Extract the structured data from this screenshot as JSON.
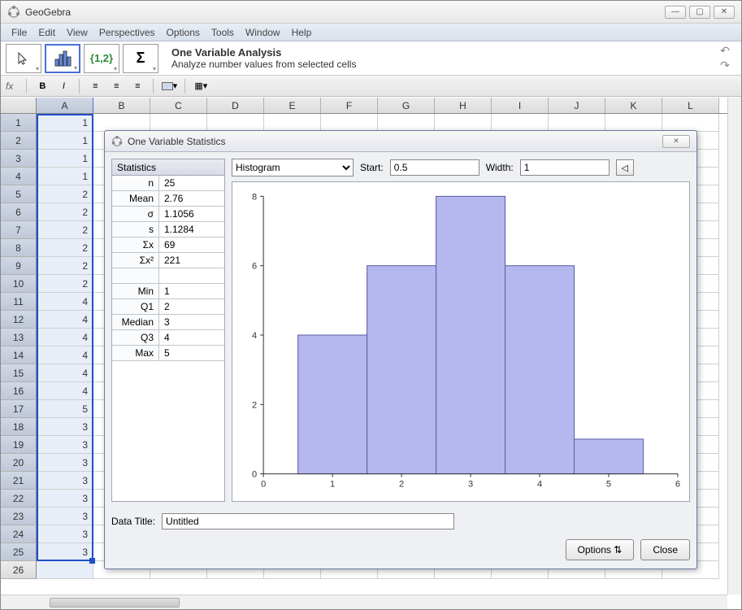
{
  "app": {
    "title": "GeoGebra"
  },
  "menu": {
    "items": [
      "File",
      "Edit",
      "View",
      "Perspectives",
      "Options",
      "Tools",
      "Window",
      "Help"
    ]
  },
  "toolbar": {
    "desc_title": "One Variable Analysis",
    "desc_sub": "Analyze number values from selected cells",
    "braces_label": "{1,2}",
    "sigma_label": "Σ"
  },
  "formatbar": {
    "fx": "fx",
    "bold": "B",
    "italic": "I"
  },
  "columns": [
    "A",
    "B",
    "C",
    "D",
    "E",
    "F",
    "G",
    "H",
    "I",
    "J",
    "K",
    "L"
  ],
  "rows": [
    "1",
    "2",
    "3",
    "4",
    "5",
    "6",
    "7",
    "8",
    "9",
    "10",
    "11",
    "12",
    "13",
    "14",
    "15",
    "16",
    "17",
    "18",
    "19",
    "20",
    "21",
    "22",
    "23",
    "24",
    "25",
    "26"
  ],
  "data_col_a": [
    "1",
    "1",
    "1",
    "1",
    "2",
    "2",
    "2",
    "2",
    "2",
    "2",
    "4",
    "4",
    "4",
    "4",
    "4",
    "4",
    "5",
    "3",
    "3",
    "3",
    "3",
    "3",
    "3",
    "3",
    "3",
    ""
  ],
  "dialog": {
    "title": "One Variable Statistics",
    "stats_header": "Statistics",
    "stats": [
      {
        "label": "n",
        "value": "25"
      },
      {
        "label": "Mean",
        "value": "2.76"
      },
      {
        "label": "σ",
        "value": "1.1056"
      },
      {
        "label": "s",
        "value": "1.1284"
      },
      {
        "label": "Σx",
        "value": "69"
      },
      {
        "label": "Σx²",
        "value": "221"
      },
      {
        "label": "",
        "value": ""
      },
      {
        "label": "Min",
        "value": "1"
      },
      {
        "label": "Q1",
        "value": "2"
      },
      {
        "label": "Median",
        "value": "3"
      },
      {
        "label": "Q3",
        "value": "4"
      },
      {
        "label": "Max",
        "value": "5"
      }
    ],
    "chart_type": "Histogram",
    "start_label": "Start:",
    "start_value": "0.5",
    "width_label": "Width:",
    "width_value": "1",
    "data_title_label": "Data Title:",
    "data_title_value": "Untitled",
    "options_btn": "Options",
    "close_btn": "Close"
  },
  "chart_data": {
    "type": "bar",
    "categories": [
      "1",
      "2",
      "3",
      "4",
      "5"
    ],
    "values": [
      4,
      6,
      8,
      6,
      1
    ],
    "xlabel": "",
    "ylabel": "",
    "xlim": [
      0,
      6
    ],
    "ylim": [
      0,
      8
    ],
    "xticks": [
      0,
      1,
      2,
      3,
      4,
      5,
      6
    ],
    "yticks": [
      0,
      2,
      4,
      6,
      8
    ],
    "bin_start": 0.5,
    "bin_width": 1,
    "bar_color": "#b4b8ee",
    "bar_stroke": "#5a5aa0",
    "title": ""
  }
}
